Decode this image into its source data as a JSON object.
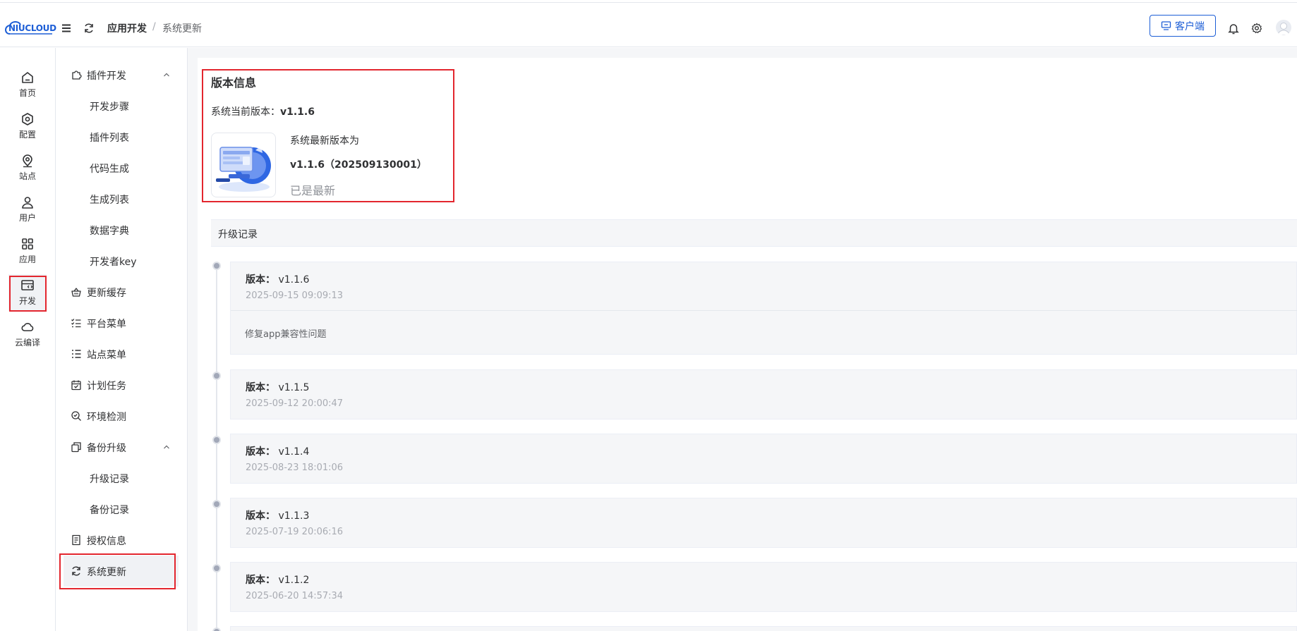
{
  "header": {
    "logo_text": "NIUCLOUD",
    "breadcrumb_main": "应用开发",
    "breadcrumb_sep": "/",
    "breadcrumb_current": "系统更新",
    "client_button": "客户端"
  },
  "rail": [
    {
      "label": "首页",
      "icon": "home-icon"
    },
    {
      "label": "配置",
      "icon": "settings-hex-icon"
    },
    {
      "label": "站点",
      "icon": "location-icon"
    },
    {
      "label": "用户",
      "icon": "user-icon"
    },
    {
      "label": "应用",
      "icon": "apps-grid-icon"
    },
    {
      "label": "开发",
      "icon": "dev-icon"
    },
    {
      "label": "云编译",
      "icon": "cloud-icon"
    }
  ],
  "submenu": {
    "plugin_dev": "插件开发",
    "dev_steps": "开发步骤",
    "plugin_list": "插件列表",
    "code_gen": "代码生成",
    "gen_list": "生成列表",
    "data_dict": "数据字典",
    "dev_key": "开发者key",
    "update_cache": "更新缓存",
    "platform_menu": "平台菜单",
    "site_menu": "站点菜单",
    "scheduled_tasks": "计划任务",
    "env_check": "环境检测",
    "backup_upgrade": "备份升级",
    "upgrade_records": "升级记录",
    "backup_records": "备份记录",
    "license_info": "授权信息",
    "system_update": "系统更新"
  },
  "version": {
    "title": "版本信息",
    "current_label": "系统当前版本：",
    "current_value": "v1.1.6",
    "latest_label": "系统最新版本为",
    "latest_value": "v1.1.6（202509130001）",
    "status": "已是最新"
  },
  "log": {
    "header": "升级记录",
    "version_label": "版本：",
    "records": [
      {
        "version": "v1.1.6",
        "time": "2025-09-15 09:09:13",
        "desc": "修复app兼容性问题"
      },
      {
        "version": "v1.1.5",
        "time": "2025-09-12 20:00:47"
      },
      {
        "version": "v1.1.4",
        "time": "2025-08-23 18:01:06"
      },
      {
        "version": "v1.1.3",
        "time": "2025-07-19 20:06:16"
      },
      {
        "version": "v1.1.2",
        "time": "2025-06-20 14:57:34"
      }
    ]
  },
  "colors": {
    "brand": "#1d5ed6",
    "highlight_box": "#e3262e",
    "muted_text": "#a8abb2"
  }
}
